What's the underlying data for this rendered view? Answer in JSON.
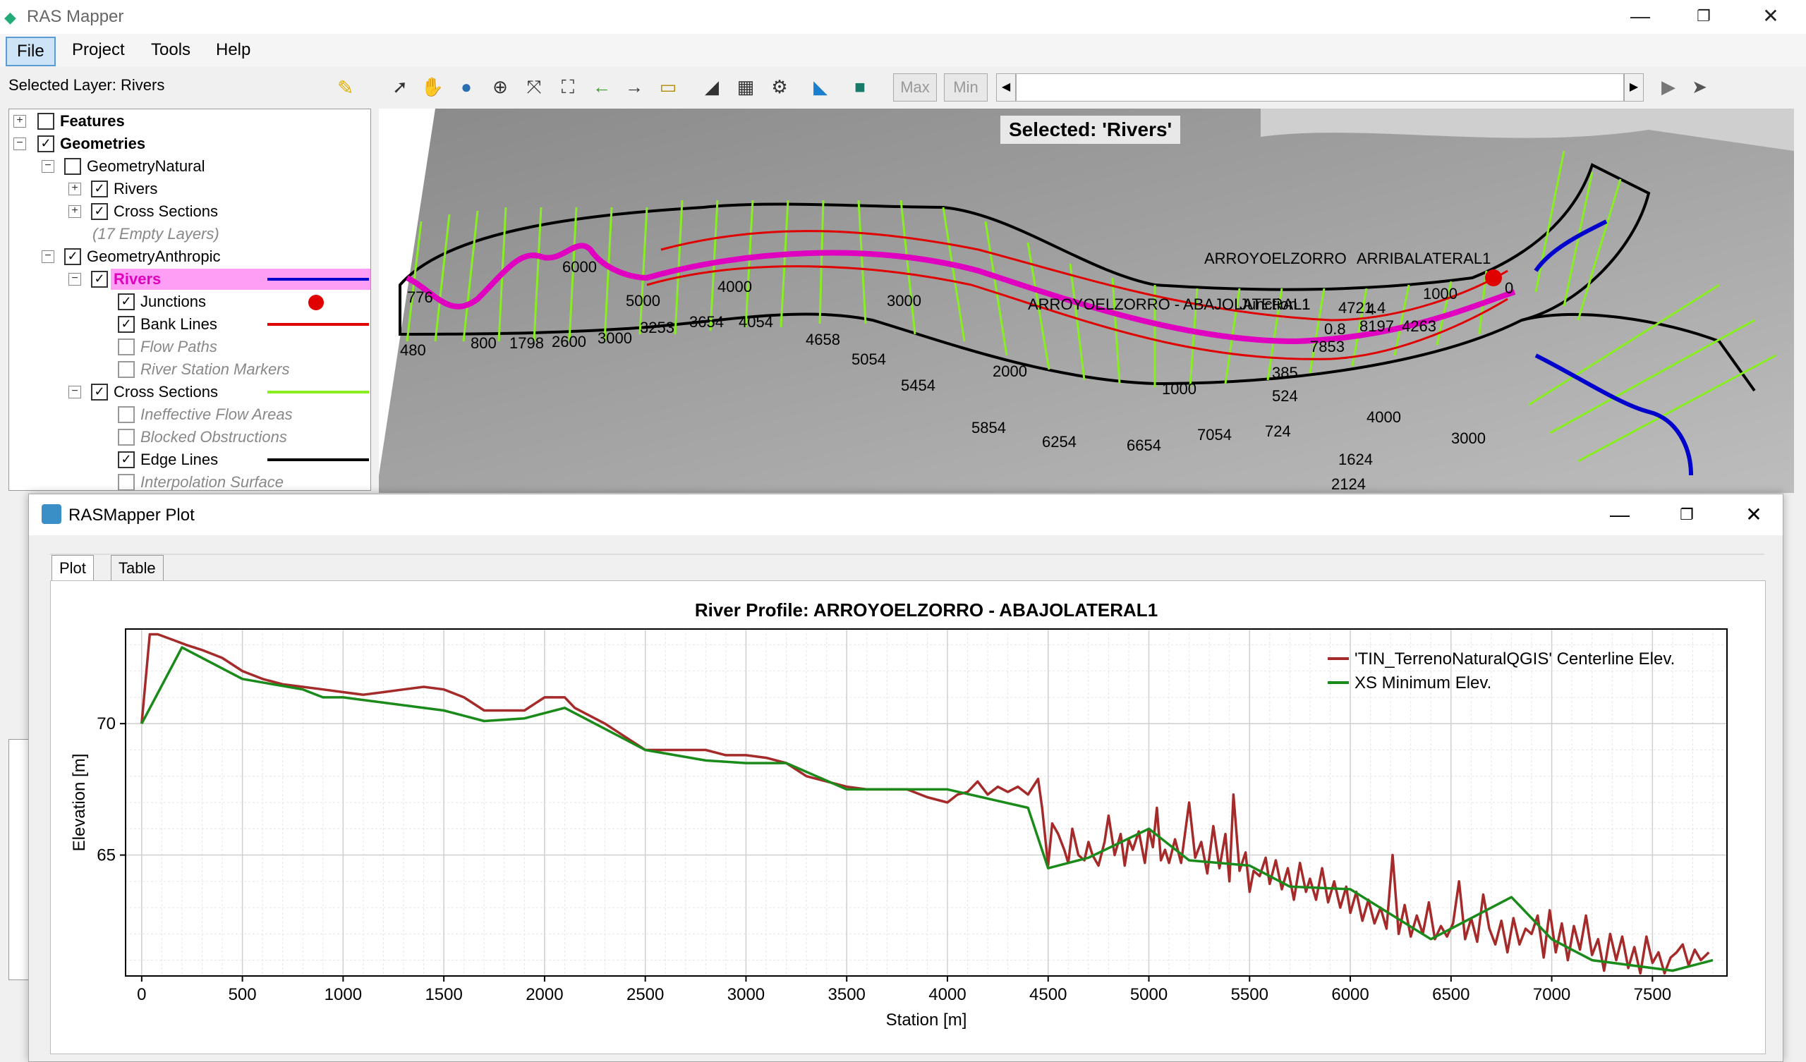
{
  "window": {
    "title": "RAS Mapper",
    "min": "—",
    "max": "❐",
    "close": "✕"
  },
  "menu": [
    "File",
    "Project",
    "Tools",
    "Help"
  ],
  "selected_layer": "Selected Layer: Rivers",
  "toolbar": {
    "max": "Max",
    "min": "Min"
  },
  "tree": {
    "features": "Features",
    "geometries": "Geometries",
    "geom_natural": "GeometryNatural",
    "rivers1": "Rivers",
    "xs1": "Cross Sections",
    "empty": "(17 Empty Layers)",
    "geom_anthropic": "GeometryAnthropic",
    "rivers2": "Rivers",
    "junctions": "Junctions",
    "bank_lines": "Bank Lines",
    "flow_paths": "Flow Paths",
    "river_station": "River Station Markers",
    "xs2": "Cross Sections",
    "ineffective": "Ineffective Flow Areas",
    "blocked": "Blocked Obstructions",
    "edge_lines": "Edge Lines",
    "interp": "Interpolation Surface"
  },
  "colors": {
    "river": "#0000cc",
    "junction": "#e00000",
    "bank": "#e00000",
    "xs": "#88ee22",
    "edge": "#000000",
    "highlight": "#ff9ef5",
    "profile": "#a52a2a",
    "minelev": "#1a8a1a"
  },
  "map": {
    "selected": "Selected: 'Rivers'",
    "labels": [
      "776",
      "480",
      "800",
      "1798",
      "2600",
      "3000",
      "3253",
      "3654",
      "4054",
      "4658",
      "5054",
      "5454",
      "5854",
      "6254",
      "6654",
      "7054",
      "724",
      "385",
      "524",
      "7853",
      "4721.4",
      "1000",
      "0",
      "3000",
      "4000",
      "1624",
      "2124",
      "2000",
      "1000",
      "3000",
      "4000",
      "5000",
      "6000",
      "ARROYOELZORRO",
      "ARRIBALATERAL1",
      "ARROYOELZORRO - ABAJOLATERAL1",
      "Junction 1",
      "4",
      "0.8",
      "8197",
      "4263"
    ]
  },
  "plot": {
    "window_title": "RASMapper Plot",
    "tabs": [
      "Plot",
      "Table"
    ]
  },
  "chart_data": {
    "type": "line",
    "title": "River Profile: ARROYOELZORRO - ABAJOLATERAL1",
    "xlabel": "Station [m]",
    "ylabel": "Elevation [m]",
    "xlim": [
      -80,
      7870
    ],
    "ylim": [
      60.4,
      73.6
    ],
    "xticks": [
      0,
      500,
      1000,
      1500,
      2000,
      2500,
      3000,
      3500,
      4000,
      4500,
      5000,
      5500,
      6000,
      6500,
      7000,
      7500
    ],
    "yticks": [
      65,
      70
    ],
    "grid": true,
    "legend": "top-right",
    "series": [
      {
        "name": "'TIN_TerrenoNaturalQGIS' Centerline Elev.",
        "color": "#a52a2a",
        "x": [
          0,
          40,
          80,
          150,
          220,
          300,
          400,
          500,
          600,
          700,
          800,
          900,
          1000,
          1100,
          1200,
          1300,
          1400,
          1500,
          1600,
          1700,
          1800,
          1900,
          2000,
          2100,
          2150,
          2200,
          2300,
          2400,
          2500,
          2600,
          2700,
          2800,
          2900,
          3000,
          3100,
          3200,
          3300,
          3400,
          3500,
          3600,
          3700,
          3800,
          3900,
          4000,
          4050,
          4100,
          4150,
          4200,
          4250,
          4300,
          4350,
          4400,
          4450,
          4470,
          4500,
          4520,
          4550,
          4580,
          4600,
          4620,
          4650,
          4680,
          4700,
          4720,
          4750,
          4780,
          4800,
          4830,
          4860,
          4880,
          4900,
          4920,
          4950,
          4980,
          5000,
          5020,
          5040,
          5060,
          5080,
          5100,
          5130,
          5160,
          5200,
          5230,
          5260,
          5290,
          5320,
          5350,
          5380,
          5400,
          5420,
          5450,
          5480,
          5500,
          5520,
          5550,
          5580,
          5600,
          5630,
          5660,
          5690,
          5720,
          5750,
          5780,
          5800,
          5830,
          5860,
          5890,
          5920,
          5950,
          5980,
          6000,
          6030,
          6060,
          6090,
          6120,
          6150,
          6180,
          6210,
          6240,
          6270,
          6300,
          6330,
          6360,
          6390,
          6420,
          6450,
          6480,
          6510,
          6540,
          6570,
          6600,
          6630,
          6660,
          6690,
          6720,
          6750,
          6780,
          6810,
          6840,
          6870,
          6900,
          6930,
          6960,
          6990,
          7020,
          7050,
          7080,
          7110,
          7140,
          7170,
          7200,
          7230,
          7260,
          7290,
          7320,
          7350,
          7380,
          7410,
          7440,
          7470,
          7500,
          7530,
          7560,
          7590,
          7620,
          7650,
          7680,
          7710,
          7740,
          7780
        ],
        "y": [
          70,
          73.4,
          73.4,
          73.2,
          73.0,
          72.8,
          72.5,
          72.0,
          71.7,
          71.5,
          71.4,
          71.3,
          71.2,
          71.1,
          71.2,
          71.3,
          71.4,
          71.3,
          71.0,
          70.5,
          70.5,
          70.5,
          71.0,
          71.0,
          70.6,
          70.4,
          70.0,
          69.5,
          69.0,
          69.0,
          69.0,
          69.0,
          68.8,
          68.8,
          68.7,
          68.5,
          68.0,
          67.8,
          67.6,
          67.5,
          67.5,
          67.5,
          67.2,
          67.0,
          67.3,
          67.4,
          67.8,
          67.3,
          67.6,
          67.4,
          67.6,
          67.3,
          67.9,
          66.8,
          64.6,
          66.2,
          65.8,
          65.2,
          64.7,
          66.0,
          65.0,
          64.8,
          65.5,
          65.0,
          64.6,
          65.5,
          66.5,
          65.0,
          65.8,
          64.6,
          65.6,
          65.2,
          65.9,
          64.7,
          66.0,
          65.3,
          66.8,
          64.8,
          65.2,
          64.7,
          65.6,
          64.7,
          67.0,
          64.9,
          65.5,
          64.3,
          66.1,
          64.5,
          65.8,
          64.0,
          67.3,
          64.4,
          65.1,
          63.6,
          64.4,
          64.2,
          64.9,
          63.9,
          64.8,
          63.7,
          64.5,
          63.3,
          64.7,
          63.6,
          64.1,
          63.3,
          64.5,
          63.2,
          64.0,
          63.0,
          63.8,
          62.8,
          63.6,
          62.5,
          63.3,
          62.4,
          63.0,
          62.2,
          65.0,
          62.0,
          63.1,
          61.9,
          62.7,
          62.0,
          63.2,
          61.8,
          62.3,
          61.9,
          62.4,
          64.0,
          61.8,
          62.6,
          61.7,
          63.5,
          62.2,
          61.6,
          62.5,
          61.3,
          62.6,
          61.6,
          62.2,
          62.0,
          62.7,
          61.1,
          62.9,
          61.3,
          62.4,
          61.0,
          62.3,
          61.4,
          62.7,
          61.2,
          61.8,
          60.6,
          62.0,
          61.0,
          61.9,
          60.7,
          61.5,
          60.5,
          61.9,
          60.9,
          61.3,
          60.5,
          61.1,
          61.3,
          61.6,
          60.8,
          61.4,
          61.0,
          61.3
        ]
      },
      {
        "name": "XS Minimum Elev.",
        "color": "#1a8a1a",
        "x": [
          0,
          200,
          500,
          800,
          900,
          1000,
          1500,
          1700,
          1900,
          2100,
          2500,
          2800,
          3000,
          3200,
          3500,
          4000,
          4400,
          4500,
          4700,
          5000,
          5200,
          5500,
          5700,
          6000,
          6400,
          6800,
          7000,
          7200,
          7600,
          7800
        ],
        "y": [
          70,
          72.9,
          71.7,
          71.3,
          71.0,
          71.0,
          70.5,
          70.1,
          70.2,
          70.6,
          69.0,
          68.6,
          68.5,
          68.5,
          67.5,
          67.5,
          66.8,
          64.5,
          64.9,
          66.0,
          64.8,
          64.6,
          63.8,
          63.7,
          61.8,
          63.4,
          61.8,
          61.0,
          60.6,
          61.0
        ]
      }
    ]
  }
}
